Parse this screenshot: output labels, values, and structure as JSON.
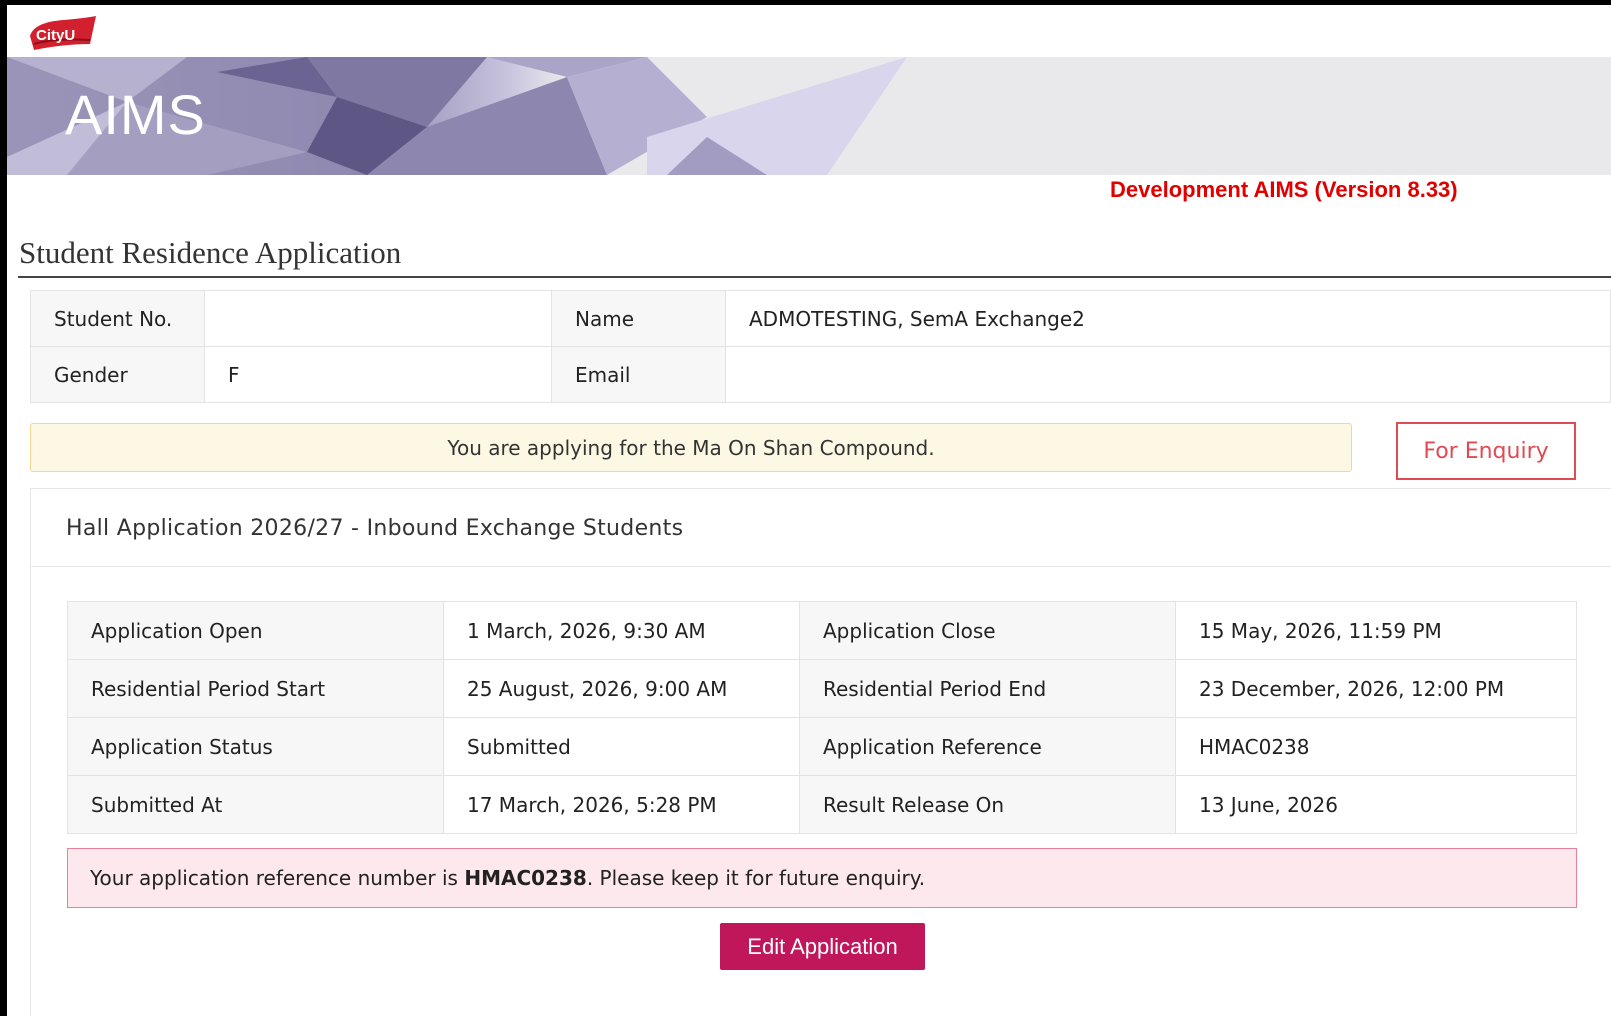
{
  "header": {
    "logo_text": "CityU",
    "app_title": "AIMS",
    "environment_label": "Development AIMS (Version 8.33)"
  },
  "page_title": "Student Residence Application",
  "student": {
    "student_no_label": "Student No.",
    "student_no_value": "",
    "name_label": "Name",
    "name_value": "ADMOTESTING, SemA Exchange2",
    "gender_label": "Gender",
    "gender_value": "F",
    "email_label": "Email",
    "email_value": ""
  },
  "notice": "You are applying for the Ma On Shan Compound.",
  "enquiry_button": "For Enquiry",
  "panel": {
    "title": "Hall Application 2026/27 - Inbound Exchange Students",
    "details": [
      {
        "label1": "Application Open",
        "value1": "1 March, 2026, 9:30 AM",
        "label2": "Application Close",
        "value2": "15 May, 2026, 11:59 PM"
      },
      {
        "label1": "Residential Period Start",
        "value1": "25 August, 2026, 9:00 AM",
        "label2": "Residential Period End",
        "value2": "23 December, 2026, 12:00 PM"
      },
      {
        "label1": "Application Status",
        "value1": "Submitted",
        "label2": "Application Reference",
        "value2": "HMAC0238"
      },
      {
        "label1": "Submitted At",
        "value1": "17 March, 2026, 5:28 PM",
        "label2": "Result Release On",
        "value2": "13 June, 2026"
      }
    ],
    "alert_prefix": "Your application reference number is ",
    "alert_reference": "HMAC0238",
    "alert_suffix": ". Please keep it for future enquiry.",
    "edit_button": "Edit Application"
  },
  "colors": {
    "environment_label": "#e00000",
    "enquiry_border": "#e04a52",
    "edit_button_bg": "#c0175b",
    "notice_bg": "#fcf8e3",
    "alert_bg": "#fde8ee"
  }
}
